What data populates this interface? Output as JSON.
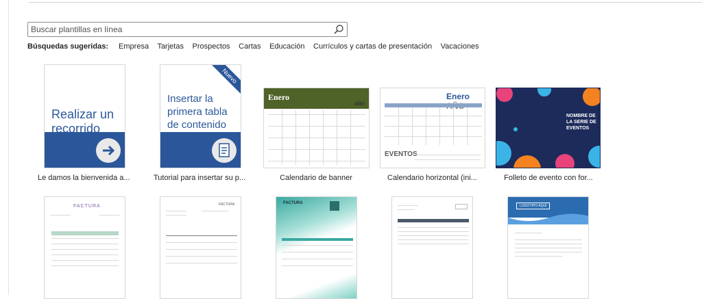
{
  "search": {
    "placeholder": "Buscar plantillas en línea"
  },
  "suggested": {
    "label": "Búsquedas sugeridas:",
    "links": [
      "Empresa",
      "Tarjetas",
      "Prospectos",
      "Cartas",
      "Educación",
      "Currículos y cartas de presentación",
      "Vacaciones"
    ]
  },
  "templates": [
    {
      "caption": "Le damos la bienvenida a...",
      "thumb_text": "Realizar un recorrido"
    },
    {
      "caption": "Tutorial para insertar su p...",
      "thumb_text": "Insertar la primera tabla de contenido",
      "badge": "Nuevo"
    },
    {
      "caption": "Calendario de banner",
      "thumb_title": "Enero",
      "thumb_sub": "AÑO"
    },
    {
      "caption": "Calendario horizontal (ini...",
      "thumb_title": "Enero",
      "thumb_sub": "AÑO",
      "thumb_footer": "EVENTOS"
    },
    {
      "caption": "Folleto de evento con for...",
      "thumb_title": "NOMBRE DE LA SERIE DE EVENTOS"
    }
  ],
  "row2": [
    {
      "thumb_title": "FACTURA"
    },
    {
      "thumb_title": "FACTURA"
    },
    {
      "thumb_title": "FACTURA"
    },
    {
      "thumb_title": ""
    },
    {
      "thumb_title": "LOGOTIPO AQUÍ"
    }
  ],
  "colors": {
    "accent": "#2b579a",
    "calendar_head": "#4f6228"
  }
}
